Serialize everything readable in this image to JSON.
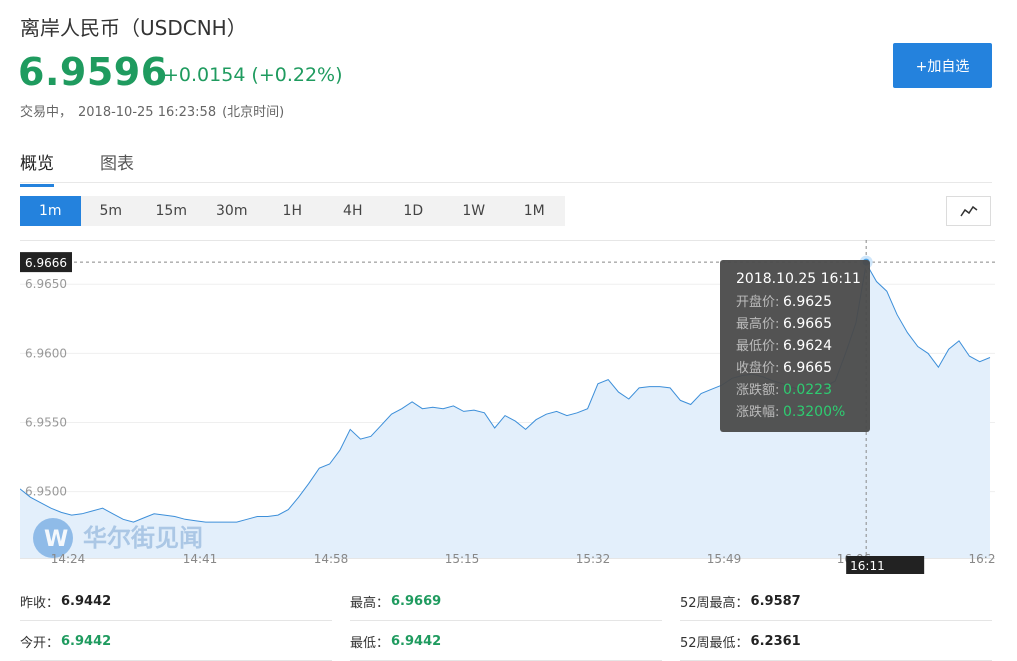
{
  "header": {
    "title": "离岸人民币（USDCNH）",
    "price": "6.9596",
    "change": "+0.0154",
    "change_pct": "(+0.22%)",
    "status": "交易中，",
    "datetime": "2018-10-25 16:23:58",
    "timezone": "(北京时间)",
    "add_button": "+加自选"
  },
  "tabs": [
    {
      "label": "概览",
      "active": true
    },
    {
      "label": "图表",
      "active": false
    }
  ],
  "periods": [
    {
      "label": "1m",
      "active": true
    },
    {
      "label": "5m"
    },
    {
      "label": "15m"
    },
    {
      "label": "30m"
    },
    {
      "label": "1H"
    },
    {
      "label": "4H"
    },
    {
      "label": "1D"
    },
    {
      "label": "1W"
    },
    {
      "label": "1M"
    }
  ],
  "watermark": "华尔街见闻",
  "chart_data": {
    "type": "area",
    "y_ticks": [
      "6.9650",
      "6.9600",
      "6.9550",
      "6.9500"
    ],
    "x_ticks": [
      "14:24",
      "14:41",
      "14:58",
      "15:15",
      "15:32",
      "15:49",
      "16:06",
      "16:2"
    ],
    "ylim": [
      6.9452,
      6.9682
    ],
    "crosshair_value": "6.9666",
    "crosshair_time": "16:11",
    "series": [
      {
        "values": [
          6.9502,
          6.9496,
          6.9492,
          6.9488,
          6.9485,
          6.9483,
          6.9484,
          6.9486,
          6.9488,
          6.9484,
          6.948,
          6.9478,
          6.9481,
          6.9484,
          6.9483,
          6.9482,
          6.948,
          6.9479,
          6.9478,
          6.9478,
          6.9478,
          6.9478,
          6.948,
          6.9482,
          6.9482,
          6.9483,
          6.9487,
          6.9496,
          6.9506,
          6.9517,
          6.952,
          6.953,
          6.9545,
          6.9538,
          6.954,
          6.9548,
          6.9556,
          6.956,
          6.9565,
          6.956,
          6.9561,
          6.956,
          6.9562,
          6.9558,
          6.9559,
          6.9557,
          6.9546,
          6.9555,
          6.9551,
          6.9545,
          6.9552,
          6.9556,
          6.9558,
          6.9555,
          6.9557,
          6.956,
          6.9578,
          6.9581,
          6.9572,
          6.9567,
          6.9575,
          6.9576,
          6.9576,
          6.9575,
          6.9566,
          6.9563,
          6.9571,
          6.9574,
          6.9577,
          6.9582,
          6.9584,
          6.9585,
          6.9583,
          6.958,
          6.9578,
          6.9575,
          6.9573,
          6.9574,
          6.9576,
          6.958,
          6.96,
          6.9622,
          6.9665,
          6.9652,
          6.9645,
          6.9628,
          6.9615,
          6.9605,
          6.96,
          6.959,
          6.9603,
          6.9609,
          6.9598,
          6.9594,
          6.9597
        ]
      }
    ],
    "tooltip": {
      "time": "2018.10.25 16:11",
      "rows": [
        {
          "label": "开盘价:",
          "value": "6.9625"
        },
        {
          "label": "最高价:",
          "value": "6.9665"
        },
        {
          "label": "最低价:",
          "value": "6.9624"
        },
        {
          "label": "收盘价:",
          "value": "6.9665"
        },
        {
          "label": "涨跌额:",
          "value": "0.0223"
        },
        {
          "label": "涨跌幅:",
          "value": "0.3200%"
        }
      ]
    }
  },
  "stats": {
    "row1": [
      {
        "label": "昨收：",
        "value": "6.9442"
      },
      {
        "label": "最高：",
        "value": "6.9669"
      },
      {
        "label": "52周最高：",
        "value": "6.9587"
      }
    ],
    "row2": [
      {
        "label": "今开：",
        "value": "6.9442"
      },
      {
        "label": "最低：",
        "value": "6.9442"
      },
      {
        "label": "52周最低：",
        "value": "6.2361"
      }
    ]
  },
  "colors": {
    "up_green": "#1f9b5f",
    "accent_blue": "#2482dd",
    "line_blue": "#3d8fd9",
    "area_fill": "#e3effb",
    "tooltip_bg": "#4a4a4a"
  }
}
